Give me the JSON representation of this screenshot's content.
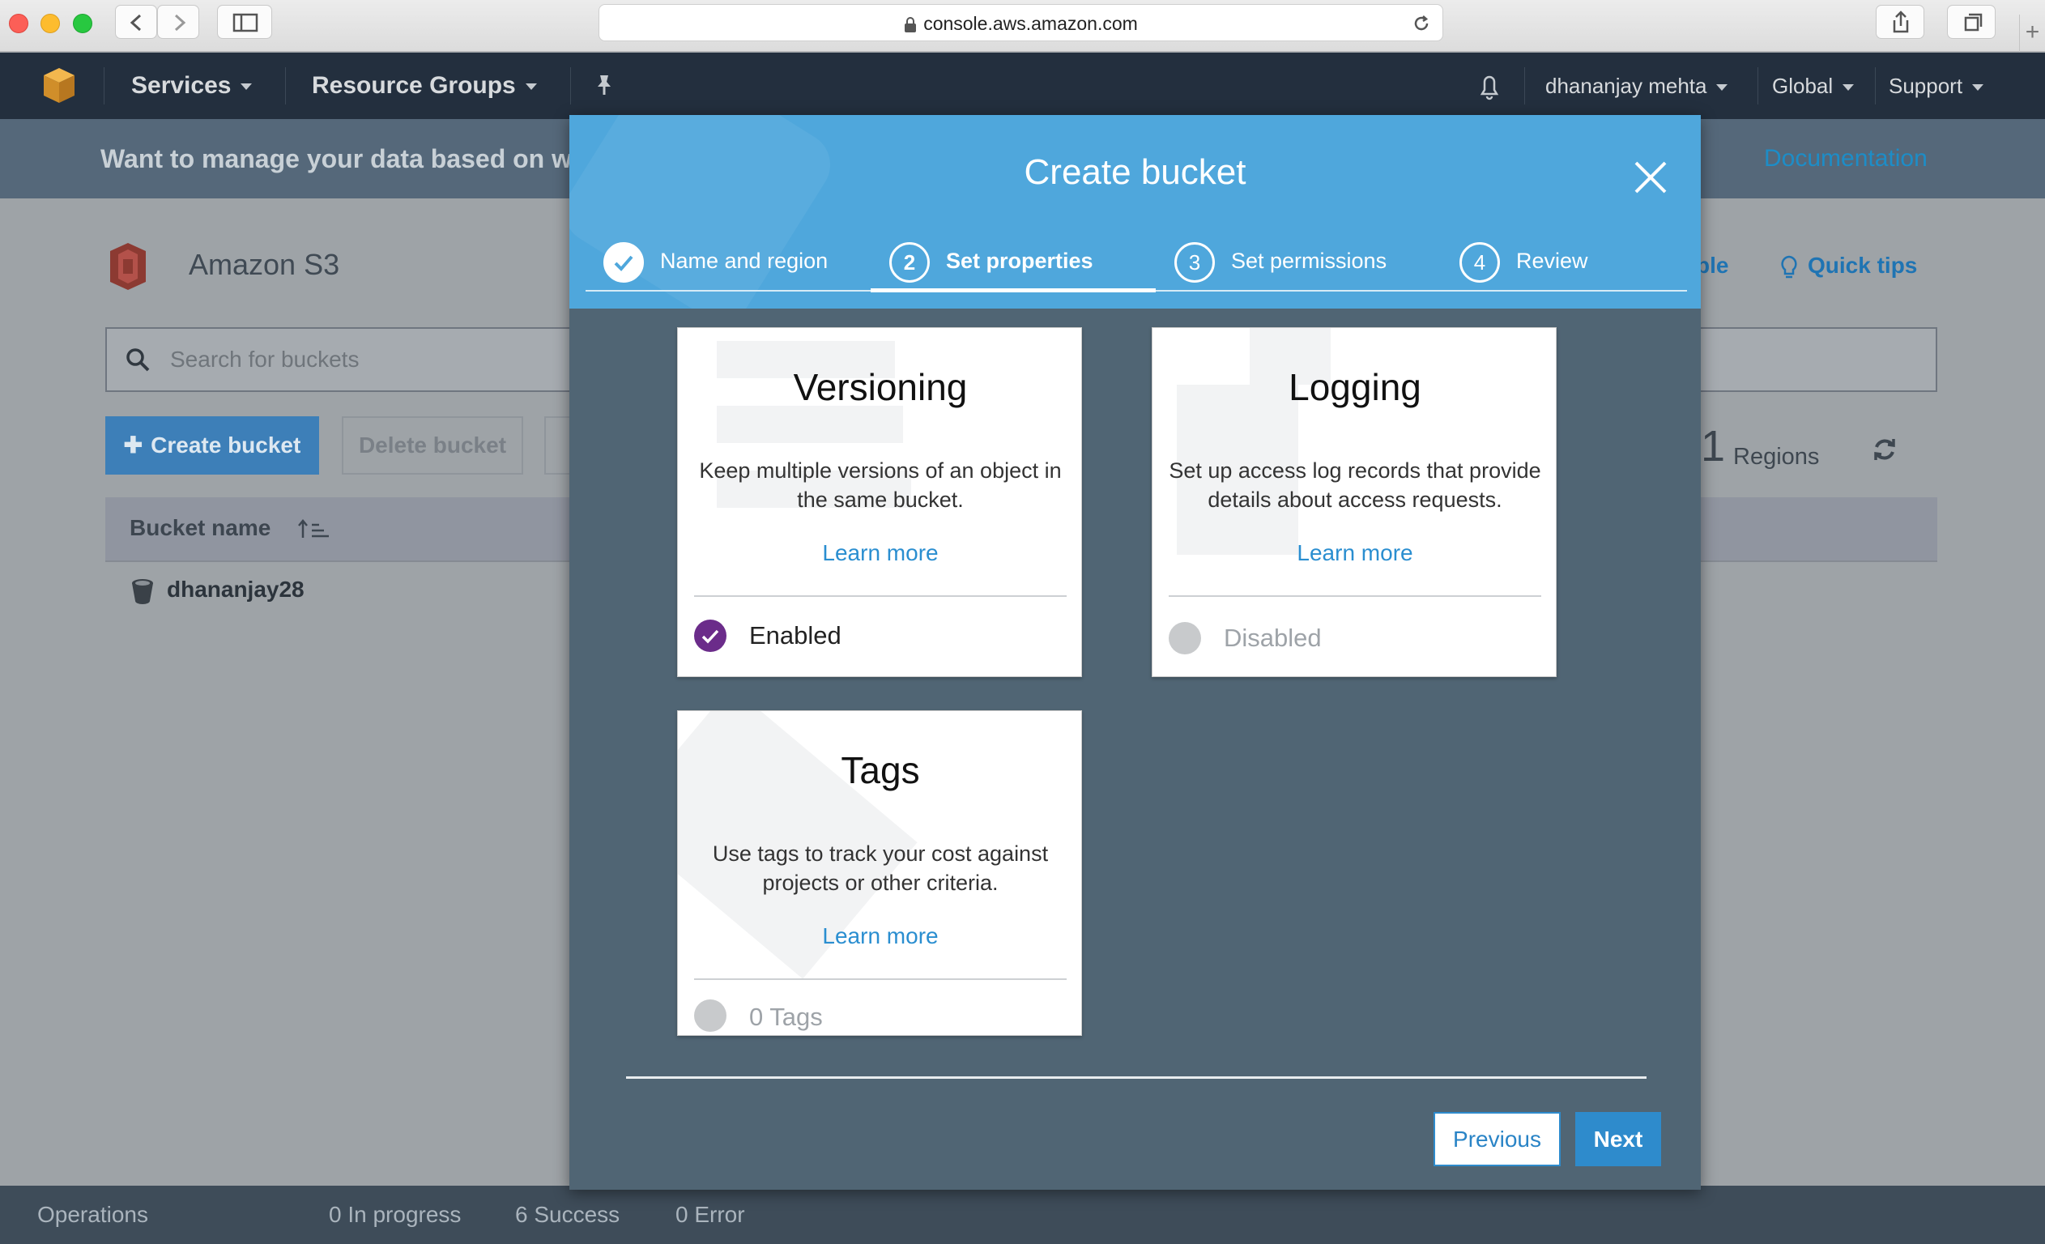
{
  "browser": {
    "url": "console.aws.amazon.com"
  },
  "topnav": {
    "services": "Services",
    "resource_groups": "Resource Groups",
    "user": "dhananjay mehta",
    "region": "Global",
    "support": "Support"
  },
  "banner": {
    "text": "Want to manage your data based on w",
    "documentation": "Documentation"
  },
  "s3": {
    "title": "Amazon S3",
    "peek_link_1": "ble",
    "quick_tips": "Quick tips",
    "search_placeholder": "Search for buckets",
    "create_button": "Create bucket",
    "delete_button": "Delete bucket",
    "regions_count": "1",
    "regions_label": "Regions",
    "table_header": "Bucket name",
    "buckets": [
      "dhananjay28"
    ]
  },
  "footer": {
    "operations": "Operations",
    "in_progress": "0 In progress",
    "success": "6 Success",
    "error": "0 Error"
  },
  "modal": {
    "title": "Create bucket",
    "steps": [
      {
        "num": "1",
        "label": "Name and region",
        "state": "done"
      },
      {
        "num": "2",
        "label": "Set properties",
        "state": "active"
      },
      {
        "num": "3",
        "label": "Set permissions",
        "state": "todo"
      },
      {
        "num": "4",
        "label": "Review",
        "state": "todo"
      }
    ],
    "cards": [
      {
        "title": "Versioning",
        "description": "Keep multiple versions of an object in the same bucket.",
        "learn_more": "Learn more",
        "status": "Enabled",
        "enabled": true
      },
      {
        "title": "Logging",
        "description": "Set up access log records that provide details about access requests.",
        "learn_more": "Learn more",
        "status": "Disabled",
        "enabled": false
      },
      {
        "title": "Tags",
        "description": "Use tags to track your cost against projects or other criteria.",
        "learn_more": "Learn more",
        "status": "0 Tags",
        "enabled": false
      }
    ],
    "previous": "Previous",
    "next": "Next"
  },
  "colors": {
    "aws_nav": "#232f3e",
    "modal_header": "#4fa7dc",
    "modal_body": "#506574",
    "primary": "#2e8bcc",
    "enabled_check": "#6b2c8a"
  }
}
